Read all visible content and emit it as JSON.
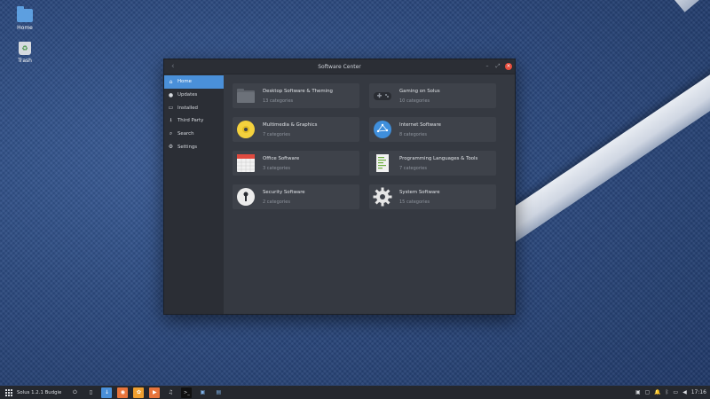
{
  "desktop": {
    "icons": [
      {
        "label": "Home",
        "icon": "folder-icon"
      },
      {
        "label": "Trash",
        "icon": "trash-icon"
      }
    ]
  },
  "window": {
    "title": "Software Center",
    "controls": {
      "back": "‹",
      "minimize": "–",
      "maximize": "⤢",
      "close": "×"
    }
  },
  "sidebar": {
    "items": [
      {
        "label": "Home",
        "icon": "home-icon",
        "glyph": "⌂",
        "active": true
      },
      {
        "label": "Updates",
        "icon": "updates-icon",
        "glyph": "●",
        "active": false
      },
      {
        "label": "Installed",
        "icon": "monitor-icon",
        "glyph": "▭",
        "active": false
      },
      {
        "label": "Third Party",
        "icon": "download-icon",
        "glyph": "⭳",
        "active": false
      },
      {
        "label": "Search",
        "icon": "search-icon",
        "glyph": "⌕",
        "active": false
      },
      {
        "label": "Settings",
        "icon": "settings-icon",
        "glyph": "⚙",
        "active": false
      }
    ]
  },
  "categories": [
    {
      "title": "Desktop Software & Theming",
      "sub": "13 categories",
      "icon": "desktop-folder-icon"
    },
    {
      "title": "Gaming on Solus",
      "sub": "10 categories",
      "icon": "gamepad-icon"
    },
    {
      "title": "Multimedia & Graphics",
      "sub": "7 categories",
      "icon": "disc-icon"
    },
    {
      "title": "Internet Software",
      "sub": "8 categories",
      "icon": "network-globe-icon"
    },
    {
      "title": "Office Software",
      "sub": "3 categories",
      "icon": "calendar-icon"
    },
    {
      "title": "Programming Languages & Tools",
      "sub": "7 categories",
      "icon": "code-document-icon"
    },
    {
      "title": "Security Software",
      "sub": "2 categories",
      "icon": "keyhole-icon"
    },
    {
      "title": "System Software",
      "sub": "15 categories",
      "icon": "gear-icon"
    }
  ],
  "taskbar": {
    "menu_label": "Solus 1.2.1 Budgie",
    "clock": "17:16",
    "apps": [
      {
        "icon": "power-icon",
        "glyph": "⏻"
      },
      {
        "icon": "files-icon",
        "glyph": "▯"
      },
      {
        "icon": "software-center-icon",
        "glyph": "↓"
      },
      {
        "icon": "firefox-icon",
        "glyph": "◉"
      },
      {
        "icon": "hexchat-icon",
        "glyph": "✿"
      },
      {
        "icon": "rhythmbox-icon",
        "glyph": "▶"
      },
      {
        "icon": "music-icon",
        "glyph": "♫"
      },
      {
        "icon": "terminal-icon",
        "glyph": ">_"
      },
      {
        "icon": "software-window-icon",
        "glyph": "▣"
      },
      {
        "icon": "folder-window-icon",
        "glyph": "▤"
      }
    ],
    "tray": [
      {
        "icon": "window-icon",
        "glyph": "▣"
      },
      {
        "icon": "chat-icon",
        "glyph": "▢"
      },
      {
        "icon": "bell-icon",
        "glyph": "🔔"
      },
      {
        "icon": "bluetooth-icon",
        "glyph": "ᛒ"
      },
      {
        "icon": "network-icon",
        "glyph": "▭"
      },
      {
        "icon": "volume-icon",
        "glyph": "◀"
      }
    ]
  },
  "colors": {
    "accent": "#4a90d9",
    "window_bg": "#353941",
    "card_bg": "#3e424a",
    "sidebar_bg": "#2b2e35",
    "close": "#e74c3c"
  }
}
